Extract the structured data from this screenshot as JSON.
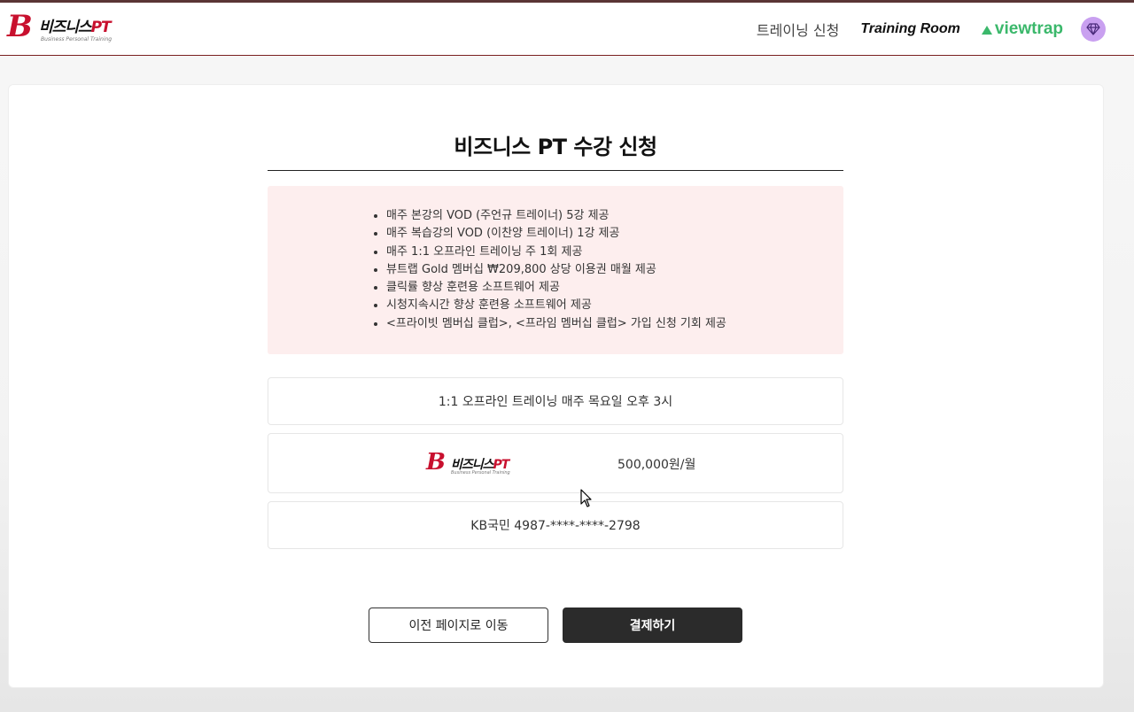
{
  "header": {
    "logo": {
      "mark": "B",
      "name": "비즈니스",
      "pt": "PT",
      "sub": "Business Personal Training"
    },
    "nav": {
      "apply": "트레이닝 신청",
      "training_room": "Training Room",
      "viewtrap": "viewtrap"
    },
    "icons": {
      "membership": "gem-icon"
    }
  },
  "page": {
    "title": "비즈니스 PT 수강 신청",
    "benefits": [
      "매주 본강의 VOD (주언규 트레이너) 5강 제공",
      "매주 복습강의 VOD (이찬양 트레이너) 1강 제공",
      "매주 1:1 오프라인 트레이닝 주 1회 제공",
      "뷰트랩 Gold 멤버십 ₩209,800 상당 이용권 매월 제공",
      "클릭률 향상 훈련용 소프트웨어 제공",
      "시청지속시간 향상 훈련용 소프트웨어 제공",
      "<프라이빗 멤버십 클럽>, <프라임 멤버십 클럽> 가입 신청 기회 제공"
    ],
    "schedule": "1:1 오프라인 트레이닝 매주 목요일 오후 3시",
    "product": {
      "price": "500,000원/월"
    },
    "payment_card": "KB국민 4987-****-****-2798",
    "buttons": {
      "prev": "이전 페이지로 이동",
      "pay": "결제하기"
    }
  },
  "colors": {
    "brand_red": "#c8102e",
    "viewtrap_green": "#3bb86b",
    "gem_purple": "#c9a0f0",
    "benefit_bg": "#fdeeee"
  }
}
